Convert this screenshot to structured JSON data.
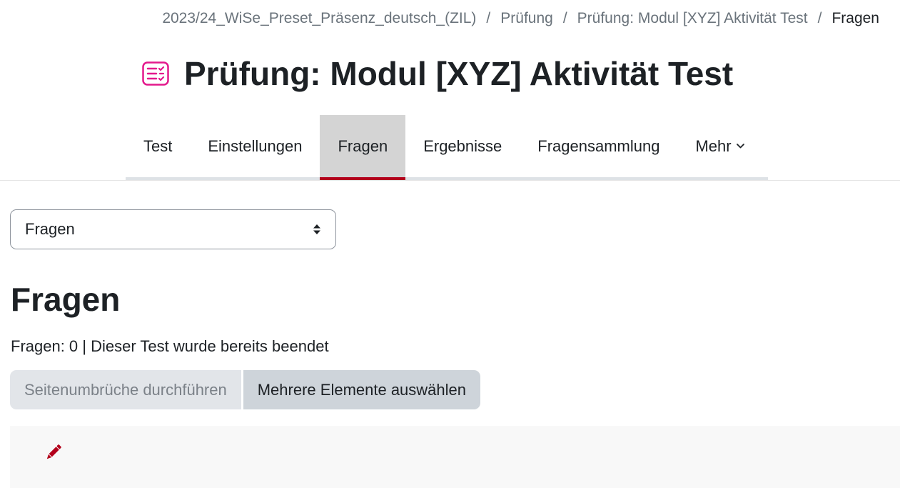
{
  "breadcrumb": {
    "items": [
      "2023/24_WiSe_Preset_Präsenz_deutsch_(ZIL)",
      "Prüfung",
      "Prüfung: Modul [XYZ] Aktivität Test",
      "Fragen"
    ],
    "separator": "/"
  },
  "header": {
    "icon": "quiz-icon",
    "icon_color": "#e3198c",
    "title": "Prüfung: Modul [XYZ] Aktivität Test"
  },
  "tabs": {
    "items": [
      "Test",
      "Einstellungen",
      "Fragen",
      "Ergebnisse",
      "Fragensammlung",
      "Mehr"
    ],
    "active": "Fragen",
    "active_indicator_color": "#b3001b"
  },
  "select": {
    "value": "Fragen",
    "icon": "sort-updown-icon"
  },
  "main": {
    "heading": "Fragen",
    "info": "Fragen: 0 | Dieser Test wurde bereits beendet",
    "buttons": {
      "repaginate": "Seitenumbrüche durchführen",
      "select_multiple": "Mehrere Elemente auswählen"
    },
    "edit_icon": "pencil-icon",
    "edit_icon_color": "#b3001b"
  }
}
